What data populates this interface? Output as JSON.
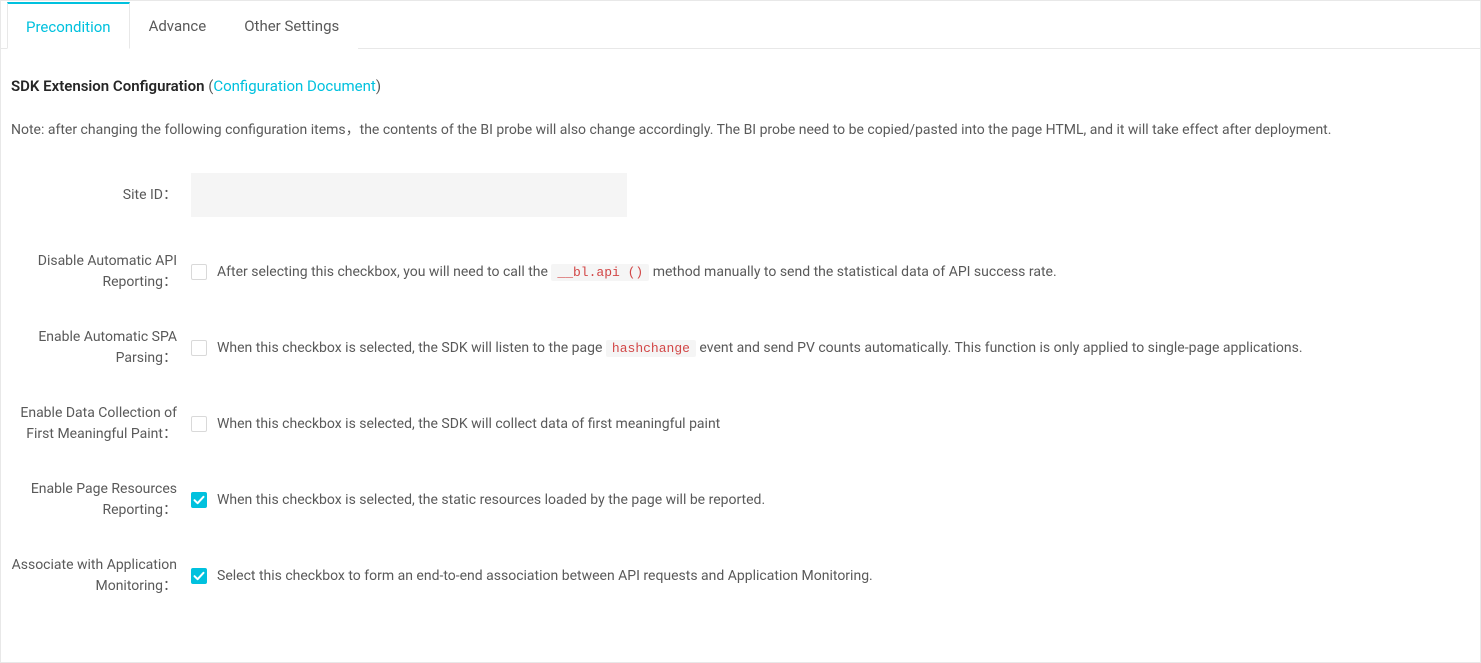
{
  "tabs": [
    {
      "label": "Precondition",
      "active": true
    },
    {
      "label": "Advance",
      "active": false
    },
    {
      "label": "Other Settings",
      "active": false
    }
  ],
  "section": {
    "title": "SDK Extension Configuration",
    "doc_link_label": "Configuration Document"
  },
  "note": "Note: after changing the following configuration items，the contents of the BI probe will also change accordingly. The BI probe need to be copied/pasted into the page HTML, and it will take effect after deployment.",
  "form": {
    "site_id": {
      "label": "Site ID：",
      "value": ""
    },
    "disable_api": {
      "label": "Disable Automatic API Reporting：",
      "checked": false,
      "desc_before": "After selecting this checkbox, you will need to call the ",
      "code": "__bl.api ()",
      "desc_after": " method manually to send the statistical data of API success rate."
    },
    "enable_spa": {
      "label": "Enable Automatic SPA Parsing：",
      "checked": false,
      "desc_before": "When this checkbox is selected, the SDK will listen to the page ",
      "code": "hashchange",
      "desc_after": " event and send PV counts automatically. This function is only applied to single-page applications."
    },
    "enable_fmp": {
      "label": "Enable Data Collection of First Meaningful Paint：",
      "checked": false,
      "desc": "When this checkbox is selected, the SDK will collect data of first meaningful paint"
    },
    "enable_resources": {
      "label": "Enable Page Resources Reporting：",
      "checked": true,
      "desc": "When this checkbox is selected, the static resources loaded by the page will be reported."
    },
    "associate_apm": {
      "label": "Associate with Application Monitoring：",
      "checked": true,
      "desc": "Select this checkbox to form an end-to-end association between API requests and Application Monitoring."
    }
  }
}
